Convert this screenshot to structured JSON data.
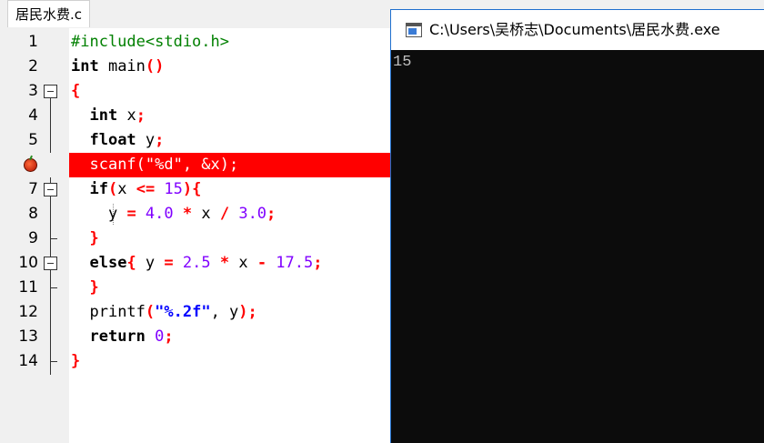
{
  "editor": {
    "tab_label": "居民水费.c",
    "lines": [
      {
        "num": "1"
      },
      {
        "num": "2"
      },
      {
        "num": "3"
      },
      {
        "num": "4"
      },
      {
        "num": "5"
      },
      {
        "num": "6",
        "breakpoint": true
      },
      {
        "num": "7"
      },
      {
        "num": "8"
      },
      {
        "num": "9"
      },
      {
        "num": "10"
      },
      {
        "num": "11"
      },
      {
        "num": "12"
      },
      {
        "num": "13"
      },
      {
        "num": "14"
      }
    ],
    "code": {
      "l1": "#include<stdio.h>",
      "l2_kw": "int",
      "l2_rest": " main",
      "l2_paren": "()",
      "l3_brace": "{",
      "l4_kw": "int",
      "l4_rest": " x",
      "l4_semi": ";",
      "l5_kw": "float",
      "l5_rest": " y",
      "l5_semi": ";",
      "l6": "scanf(\"%d\", &x);",
      "l7_kw": "if",
      "l7_p1": "(",
      "l7_x": "x ",
      "l7_op": "<=",
      "l7_num": " 15",
      "l7_p2": "){",
      "l8_y": "y ",
      "l8_eq": "=",
      "l8_n1": " 4.0",
      "l8_mul": " *",
      "l8_x": " x ",
      "l8_div": "/",
      "l8_n2": " 3.0",
      "l8_semi": ";",
      "l9_brace": "}",
      "l10_kw": "else",
      "l10_b": "{",
      "l10_y": " y ",
      "l10_eq": "=",
      "l10_n1": " 2.5",
      "l10_mul": " *",
      "l10_x": " x ",
      "l10_minus": "-",
      "l10_n2": " 17.5",
      "l10_semi": ";",
      "l11_brace": "}",
      "l12_fn": "printf",
      "l12_p1": "(",
      "l12_str": "\"%.2f\"",
      "l12_mid": ", y",
      "l12_p2": ");",
      "l13_kw": "return",
      "l13_num": " 0",
      "l13_semi": ";",
      "l14_brace": "}"
    }
  },
  "console": {
    "title": "C:\\Users\\吴桥志\\Documents\\居民水费.exe",
    "output": "15"
  },
  "colors": {
    "breakpoint_line": "#ff0000",
    "keyword": "#000000",
    "preprocessor": "#008000",
    "number": "#8000ff",
    "string": "#0000ff",
    "operator": "#ff0000"
  }
}
